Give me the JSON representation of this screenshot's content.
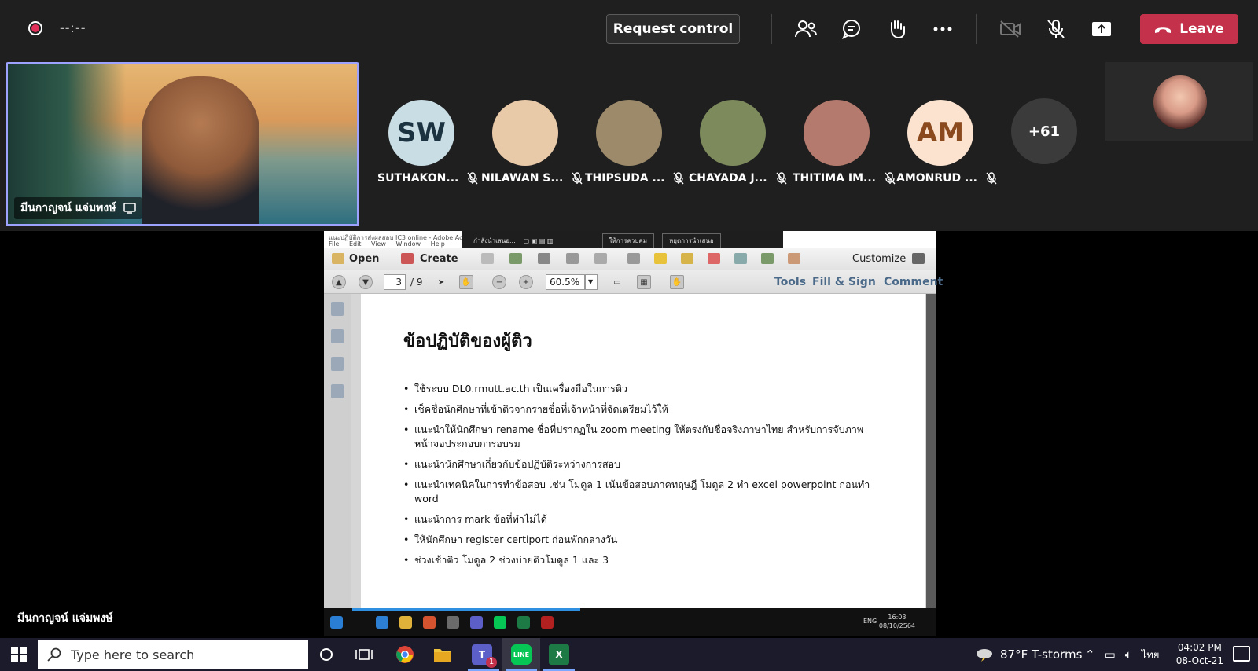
{
  "topbar": {
    "timer": "--:--",
    "request_control_label": "Request control",
    "leave_label": "Leave",
    "icons": [
      "participants-icon",
      "chat-icon",
      "raise-hand-icon",
      "more-icon",
      "camera-off-icon",
      "mic-off-icon",
      "share-icon"
    ]
  },
  "stage": {
    "presenter_tile_name": "มีนกาญจน์ แจ่มพงษ์",
    "presenter_name": "มีนกาญจน์ แจ่มพงษ์",
    "more_count": "+61"
  },
  "participants": [
    {
      "initials": "SW",
      "name": "SUTHAKON...",
      "bg": "#c9dde5",
      "fg": "#1b3340"
    },
    {
      "initials": "",
      "name": "NILAWAN S...",
      "bg": "#e8c9a8",
      "fg": "#000"
    },
    {
      "initials": "",
      "name": "THIPSUDA ...",
      "bg": "#9c8a6a",
      "fg": "#000"
    },
    {
      "initials": "",
      "name": "CHAYADA J...",
      "bg": "#7c8a5c",
      "fg": "#000"
    },
    {
      "initials": "",
      "name": "THITIMA IM...",
      "bg": "#b57a6e",
      "fg": "#000"
    },
    {
      "initials": "AM",
      "name": "AMONRUD ...",
      "bg": "#fbe3cf",
      "fg": "#8a4a1e"
    }
  ],
  "acrobat": {
    "title": "แนะปฏิบัติการส่งผลสอบ IC3 online - Adobe Acrobat",
    "menu": [
      "File",
      "Edit",
      "View",
      "Window",
      "Help"
    ],
    "share_bar_left": "กำลังนำเสนอ...",
    "share_bar_select": "ให้การควบคุม",
    "share_bar_stop": "หยุดการนำเสนอ",
    "open_label": "Open",
    "create_label": "Create",
    "customize_label": "Customize",
    "page_current": "3",
    "page_total": "/ 9",
    "zoom": "60.5%",
    "tools_label": "Tools",
    "fill_sign_label": "Fill & Sign",
    "comment_label": "Comment"
  },
  "document": {
    "heading": "ข้อปฏิบัติของผู้ติว",
    "bullets": [
      "ใช้ระบบ DL0.rmutt.ac.th เป็นเครื่องมือในการติว",
      "เช็คชื่อนักศึกษาที่เข้าติวจากรายชื่อที่เจ้าหน้าที่จัดเตรียมไว้ให้",
      "แนะนำให้นักศึกษา rename ชื่อที่ปรากฏใน zoom meeting ให้ตรงกับชื่อจริงภาษาไทย สำหรับการจับภาพหน้าจอประกอบการอบรม",
      "แนะนำนักศึกษาเกี่ยวกับข้อปฏิบัติระหว่างการสอบ",
      "แนะนำเทคนิคในการทำข้อสอบ เช่น โมดูล 1 เน้นข้อสอบภาคทฤษฎี โมดูล 2 ทำ excel powerpoint ก่อนทำ word",
      "แนะนำการ mark ข้อที่ทำไม่ได้",
      "ให้นักศึกษา register certiport ก่อนพักกลางวัน",
      "ช่วงเช้าติว โมดูล 2 ช่วงบ่ายติวโมดูล 1 และ 3"
    ]
  },
  "inner_taskbar": {
    "lang": "ENG",
    "time": "16:03",
    "date": "08/10/2564"
  },
  "taskbar": {
    "search_placeholder": "Type here to search",
    "weather": "87°F  T-storms",
    "lang": "ไทย",
    "time": "04:02 PM",
    "date": "08-Oct-21",
    "teams_badge": "1"
  },
  "colors": {
    "leave": "#c4314b",
    "active_border": "#9ea2ff",
    "topbar_bg": "#1f1f1f"
  }
}
